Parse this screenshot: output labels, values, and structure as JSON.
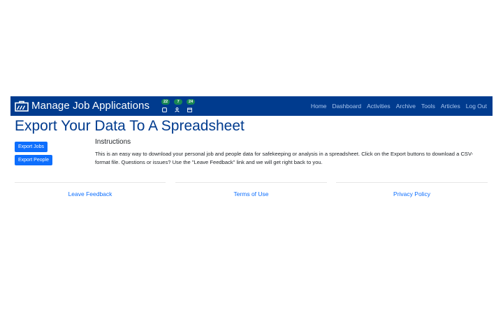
{
  "navbar": {
    "brand": "Manage Job Applications",
    "brand_icon": "briefcase-icon",
    "counters": [
      {
        "count": "22",
        "icon": "square-icon"
      },
      {
        "count": "7",
        "icon": "person-icon"
      },
      {
        "count": "24",
        "icon": "calendar-icon"
      }
    ],
    "links": [
      "Home",
      "Dashboard",
      "Activities",
      "Archive",
      "Tools",
      "Articles",
      "Log Out"
    ]
  },
  "page": {
    "title": "Export Your Data To A Spreadsheet",
    "buttons": {
      "export_jobs": "Export Jobs",
      "export_people": "Export People"
    },
    "instructions_heading": "Instructions",
    "instructions_text": "This is an easy way to download your personal job and people data for safekeeping or analysis in a spreadsheet. Click on the Export buttons to download a CSV-format file. Questions or issues? Use the \"Leave Feedback\" link and we will get right back to you."
  },
  "footer": {
    "links": [
      "Leave Feedback",
      "Terms of Use",
      "Privacy Policy"
    ]
  },
  "colors": {
    "navbar_bg": "#003b8e",
    "title": "#003b8e",
    "button": "#0d6efd",
    "badge": "#198754",
    "link": "#0d6efd"
  }
}
